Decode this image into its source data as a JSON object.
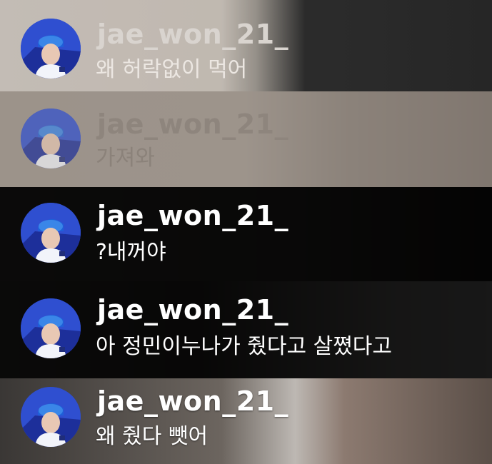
{
  "chat": {
    "messages": [
      {
        "username": "jae_won_21_",
        "text": "왜 허락없이 먹어"
      },
      {
        "username": "jae_won_21_",
        "text": "가져와"
      },
      {
        "username": "jae_won_21_",
        "text": "?내꺼야"
      },
      {
        "username": "jae_won_21_",
        "text": "아 정민이누나가 줬다고 살쪘다고"
      },
      {
        "username": "jae_won_21_",
        "text": "왜 줬다 뺏어"
      }
    ]
  },
  "icons": {
    "avatar": "user-avatar-icon"
  },
  "colors": {
    "avatar_blue": "#2b46c6",
    "text_white": "#ffffff"
  }
}
